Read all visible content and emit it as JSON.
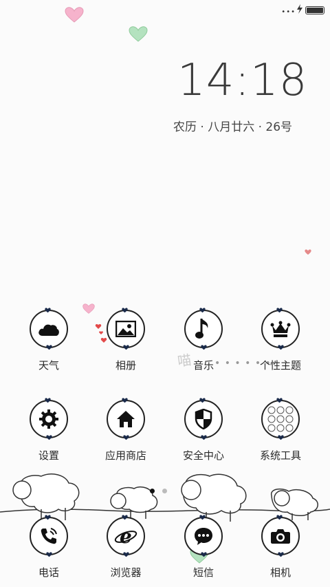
{
  "status_bar": {
    "signal_icon": "signal-dots-icon",
    "charging_icon": "bolt-icon",
    "battery_icon": "battery-icon"
  },
  "lockscreen": {
    "time": "14:18",
    "date": "农历 · 八月廿六  ·  26号"
  },
  "apps": {
    "weather": "天气",
    "gallery": "相册",
    "music": "音乐",
    "themes": "个性主题",
    "settings": "设置",
    "app_store": "应用商店",
    "security": "安全中心",
    "tools": "系统工具"
  },
  "dock": {
    "phone": "电话",
    "browser": "浏览器",
    "messages": "短信",
    "camera": "相机"
  },
  "wallpaper": {
    "meow_text": "喵",
    "dotted_line": "• • • • • •"
  },
  "colors": {
    "heart_pink": "#f3a7c4",
    "heart_green": "#a7dcb2",
    "heart_red": "#e34a4a",
    "icon_stroke": "#222222"
  },
  "pages": {
    "count": 2,
    "active": 1
  }
}
